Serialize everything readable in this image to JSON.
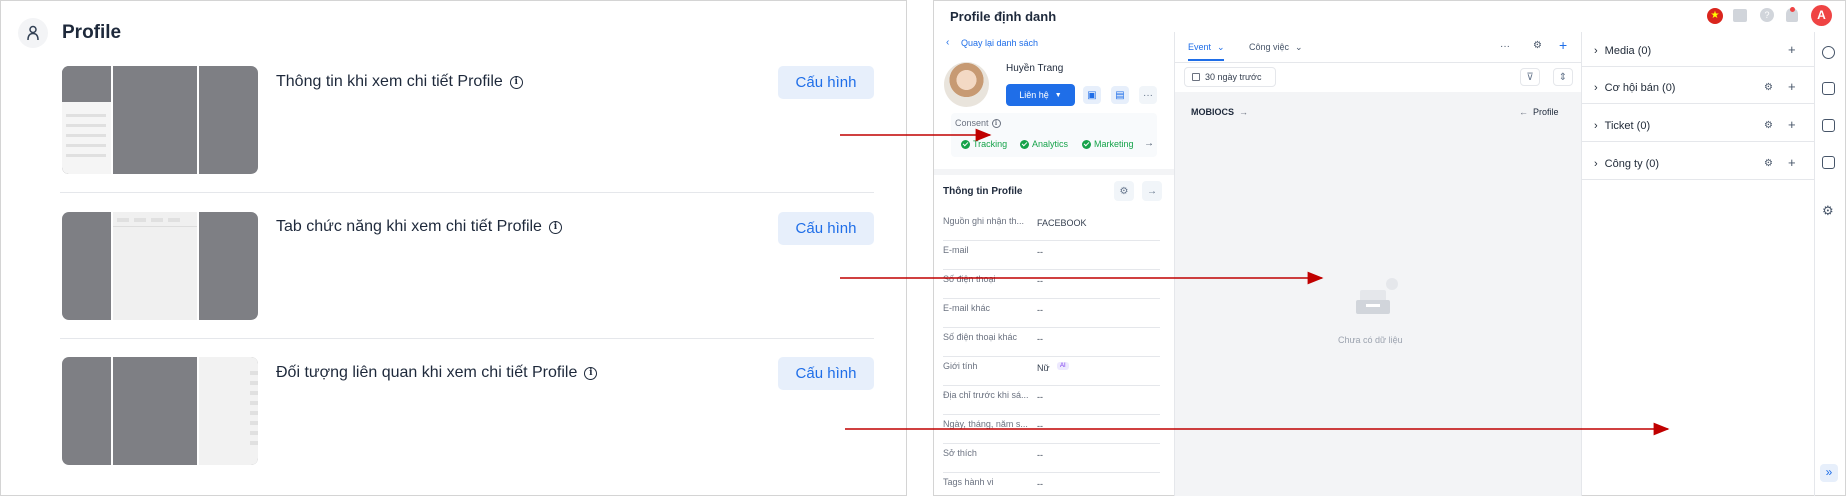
{
  "left": {
    "title": "Profile",
    "items": [
      {
        "title": "Thông tin khi xem chi tiết Profile",
        "button": "Cấu hình"
      },
      {
        "title": "Tab chức năng khi xem chi tiết Profile",
        "button": "Cấu hình"
      },
      {
        "title": "Đối tượng liên quan khi xem chi tiết Profile",
        "button": "Cấu hình"
      }
    ]
  },
  "right": {
    "header_title": "Profile định danh",
    "avatar_letter": "A",
    "back_link": "Quay lại danh sách",
    "profile_name": "Huyền Trang",
    "contact_button": "Liên hệ",
    "consent_label": "Consent",
    "consents": [
      "Tracking",
      "Analytics",
      "Marketing"
    ],
    "info_section_title": "Thông tin Profile",
    "fields": [
      {
        "label": "Nguồn ghi nhận th...",
        "value": "FACEBOOK"
      },
      {
        "label": "E-mail",
        "value": "--"
      },
      {
        "label": "Số điện thoại",
        "value": "--"
      },
      {
        "label": "E-mail khác",
        "value": "--"
      },
      {
        "label": "Số điện thoại khác",
        "value": "--"
      },
      {
        "label": "Giới tính",
        "value": "Nữ",
        "badge": "AI"
      },
      {
        "label": "Địa chỉ trước khi sá...",
        "value": "--"
      },
      {
        "label": "Ngày, tháng, năm s...",
        "value": "--"
      },
      {
        "label": "Sở thích",
        "value": "--"
      },
      {
        "label": "Tags hành vi",
        "value": "--"
      }
    ],
    "tabs": [
      "Event",
      "Công việc"
    ],
    "date_filter": "30 ngày trước",
    "source_left": "MOBIOCS",
    "source_right": "Profile",
    "empty_text": "Chưa có dữ liệu",
    "related": [
      {
        "label": "Media (0)"
      },
      {
        "label": "Cơ hội bán (0)"
      },
      {
        "label": "Ticket (0)"
      },
      {
        "label": "Công ty (0)"
      }
    ]
  },
  "colors": {
    "primary": "#1f6ee8",
    "arrow": "#c00000",
    "placeholder": "#7e7f84",
    "consent_green": "#16a34a"
  },
  "icons": [
    "user-icon",
    "info-icon",
    "chevron-left-icon",
    "chevron-down-icon",
    "clipboard-icon",
    "calendar-icon",
    "more-icon",
    "gear-icon",
    "arrow-right-icon",
    "plus-icon",
    "filter-icon",
    "collapse-icon",
    "arrow-left-icon",
    "inbox-empty-icon",
    "chevron-right-icon",
    "flag-icon",
    "book-icon",
    "help-icon",
    "bell-icon",
    "double-chevron-right-icon"
  ]
}
